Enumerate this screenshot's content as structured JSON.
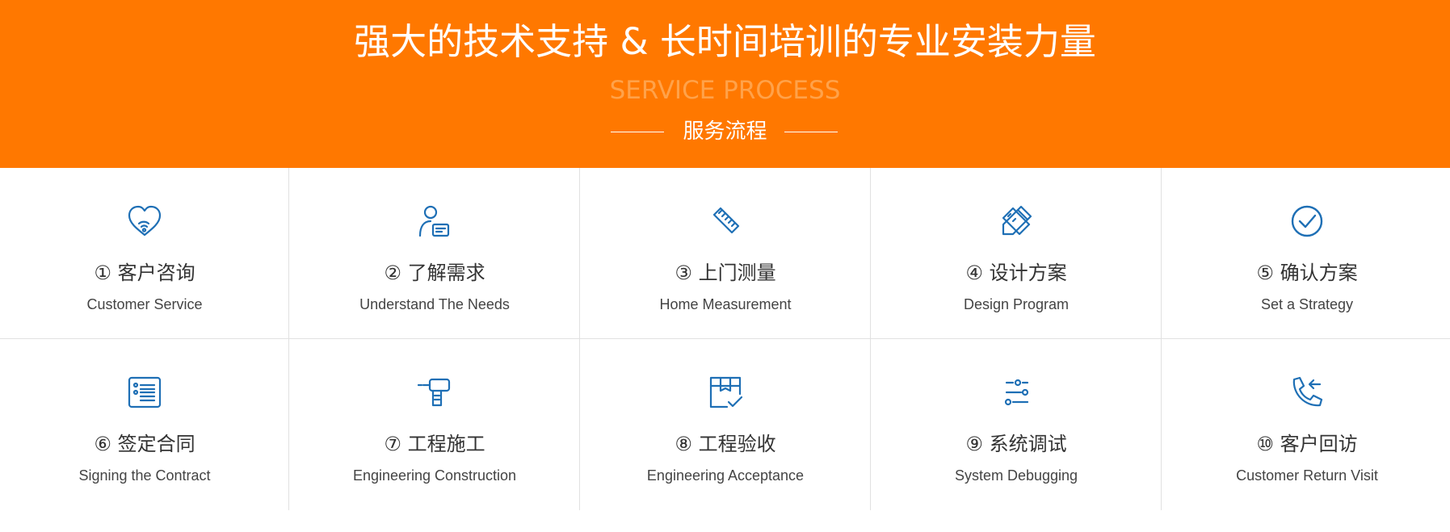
{
  "banner": {
    "title": "强大的技术支持 & 长时间培训的专业安装力量",
    "subtitle_en": "SERVICE PROCESS",
    "subtitle_cn": "服务流程",
    "bg_color": "#ff7800"
  },
  "steps": [
    {
      "title": "① 客户咨询",
      "en": "Customer Service",
      "icon": "heart-wifi-icon"
    },
    {
      "title": "② 了解需求",
      "en": "Understand The Needs",
      "icon": "user-card-icon"
    },
    {
      "title": "③ 上门测量",
      "en": "Home Measurement",
      "icon": "ruler-icon"
    },
    {
      "title": "④ 设计方案",
      "en": "Design Program",
      "icon": "design-tools-icon"
    },
    {
      "title": "⑤ 确认方案",
      "en": "Set a Strategy",
      "icon": "check-circle-icon"
    },
    {
      "title": "⑥ 签定合同",
      "en": "Signing the Contract",
      "icon": "contract-document-icon"
    },
    {
      "title": "⑦ 工程施工",
      "en": "Engineering Construction",
      "icon": "drill-icon"
    },
    {
      "title": "⑧ 工程验收",
      "en": "Engineering Acceptance",
      "icon": "box-check-icon"
    },
    {
      "title": "⑨ 系统调试",
      "en": "System Debugging",
      "icon": "sliders-icon"
    },
    {
      "title": "⑩ 客户回访",
      "en": "Customer Return Visit",
      "icon": "phone-callback-icon"
    }
  ],
  "colors": {
    "icon": "#1e6fb5",
    "title_text": "#333333",
    "divider": "#e1e1e1"
  }
}
